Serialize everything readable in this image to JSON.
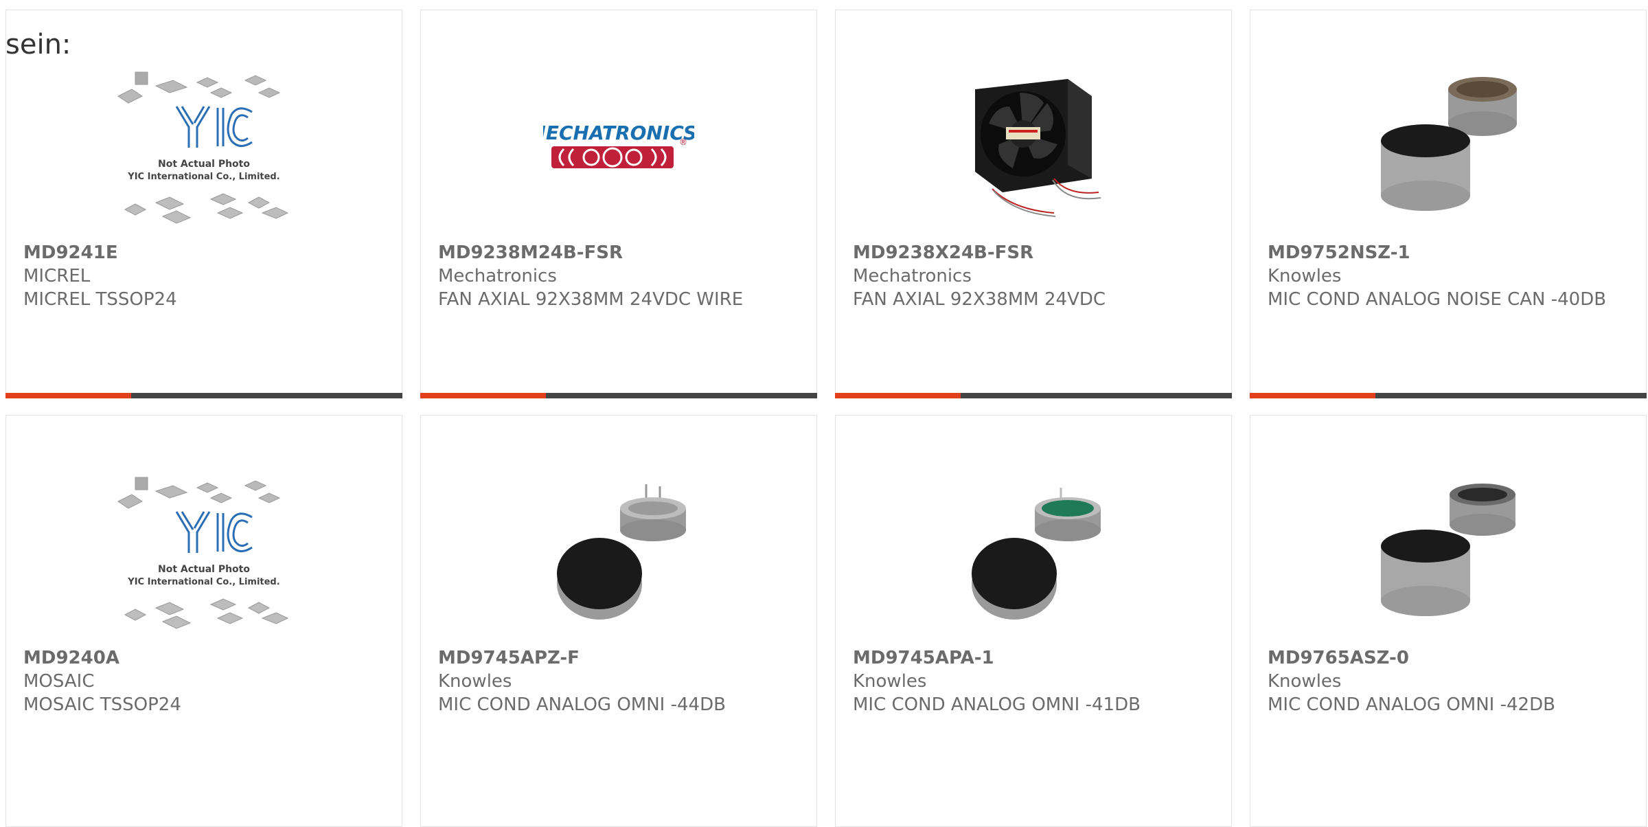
{
  "page": {
    "label": "sein:"
  },
  "colors": {
    "accent": "#e2401c",
    "bar": "#444444",
    "text": "#6b6b6b",
    "border": "#e3e3e3",
    "yic_blue": "#2a6fb5",
    "mechatronics_red": "#c0203a",
    "mechatronics_blue": "#1a6fb0"
  },
  "products": [
    {
      "part_number": "MD9241E",
      "manufacturer": "MICREL",
      "description": "MICREL TSSOP24",
      "image": "yic-placeholder",
      "placeholder_line1": "Not Actual Photo",
      "placeholder_line2": "YIC International Co., Limited."
    },
    {
      "part_number": "MD9238M24B-FSR",
      "manufacturer": "Mechatronics",
      "description": "FAN AXIAL 92X38MM 24VDC WIRE",
      "image": "mechatronics-logo",
      "logo_text": "MECHATRONICS",
      "logo_mark": "®"
    },
    {
      "part_number": "MD9238X24B-FSR",
      "manufacturer": "Mechatronics",
      "description": "FAN AXIAL 92X38MM 24VDC",
      "image": "fan-photo"
    },
    {
      "part_number": "MD9752NSZ-1",
      "manufacturer": "Knowles",
      "description": "MIC COND ANALOG NOISE CAN -40DB",
      "image": "microphone-photo"
    },
    {
      "part_number": "MD9240A",
      "manufacturer": "MOSAIC",
      "description": "MOSAIC TSSOP24",
      "image": "yic-placeholder",
      "placeholder_line1": "Not Actual Photo",
      "placeholder_line2": "YIC International Co., Limited."
    },
    {
      "part_number": "MD9745APZ-F",
      "manufacturer": "Knowles",
      "description": "MIC COND ANALOG OMNI -44DB",
      "image": "microphone-pins-photo"
    },
    {
      "part_number": "MD9745APA-1",
      "manufacturer": "Knowles",
      "description": "MIC COND ANALOG OMNI -41DB",
      "image": "microphone-green-photo"
    },
    {
      "part_number": "MD9765ASZ-0",
      "manufacturer": "Knowles",
      "description": "MIC COND ANALOG OMNI -42DB",
      "image": "microphone-photo"
    }
  ]
}
